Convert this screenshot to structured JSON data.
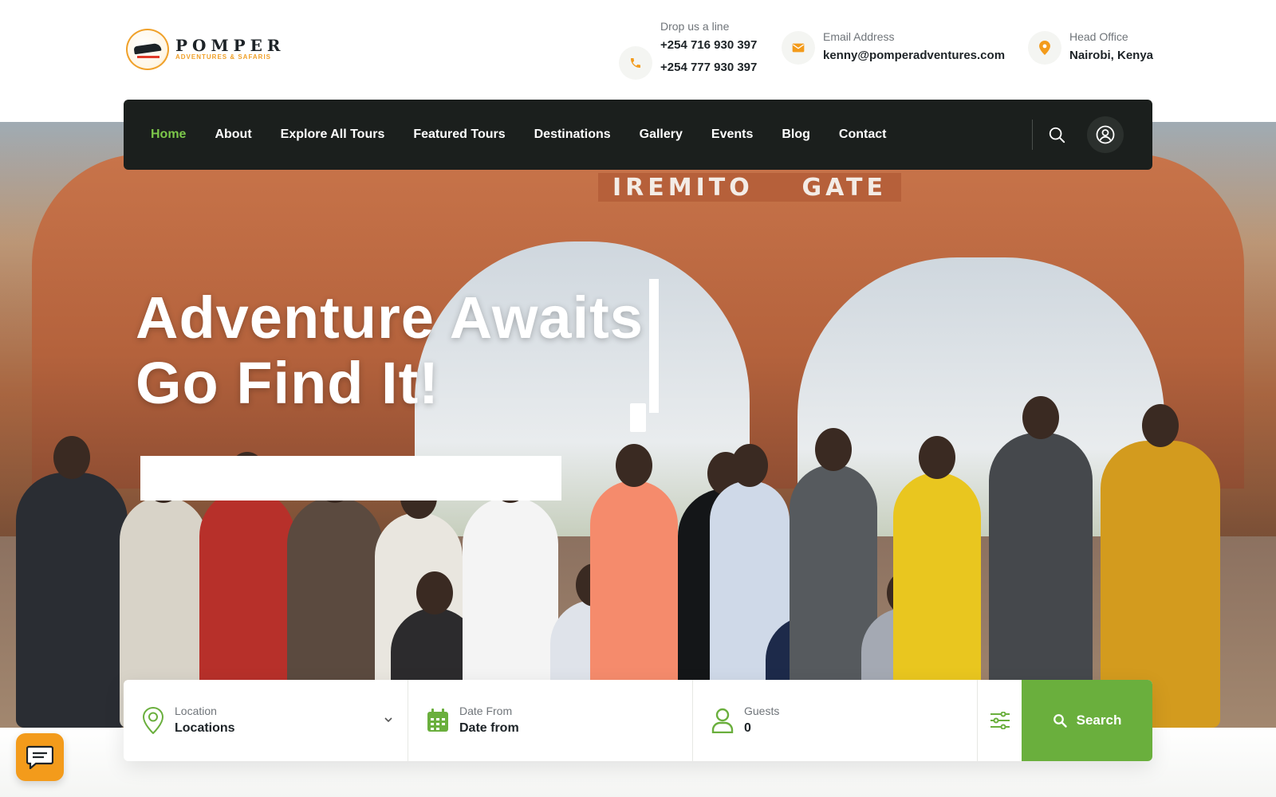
{
  "brand": {
    "name": "POMPER",
    "tagline": "ADVENTURES & SAFARIS",
    "script": "Adventure Awaits, Go Find It!",
    "badge_text": "POMPER",
    "colors": {
      "accent_green": "#6aaf3d",
      "accent_orange": "#f39b1b",
      "nav_bg": "#1b1f1d"
    }
  },
  "contacts": {
    "phone": {
      "label": "Drop us a line",
      "values": [
        "+254 716 930 397",
        "+254 777 930 397"
      ],
      "icon": "phone-icon"
    },
    "email": {
      "label": "Email Address",
      "value": "kenny@pomperadventures.com",
      "icon": "envelope-icon"
    },
    "office": {
      "label": "Head Office",
      "value": "Nairobi, Kenya",
      "icon": "map-pin-icon"
    }
  },
  "nav": {
    "items": [
      {
        "label": "Home",
        "active": true
      },
      {
        "label": "About"
      },
      {
        "label": "Explore All Tours"
      },
      {
        "label": "Featured Tours"
      },
      {
        "label": "Destinations"
      },
      {
        "label": "Gallery"
      },
      {
        "label": "Events"
      },
      {
        "label": "Blog"
      },
      {
        "label": "Contact"
      }
    ],
    "icons": [
      "search-icon",
      "user-circle-icon"
    ]
  },
  "hero": {
    "headline_line1": "Adventure Awaits",
    "headline_line2": "Go Find It!",
    "gate_sign": [
      "IREMITO",
      "GATE"
    ]
  },
  "search": {
    "location": {
      "label": "Location",
      "value": "Locations",
      "icon": "location-pin-icon"
    },
    "date": {
      "label": "Date From",
      "value": "Date from",
      "icon": "calendar-icon"
    },
    "guests": {
      "label": "Guests",
      "value": "0",
      "icon": "user-icon"
    },
    "filter_icon": "sliders-icon",
    "button_label": "Search"
  },
  "chat": {
    "icon": "chat-icon"
  }
}
